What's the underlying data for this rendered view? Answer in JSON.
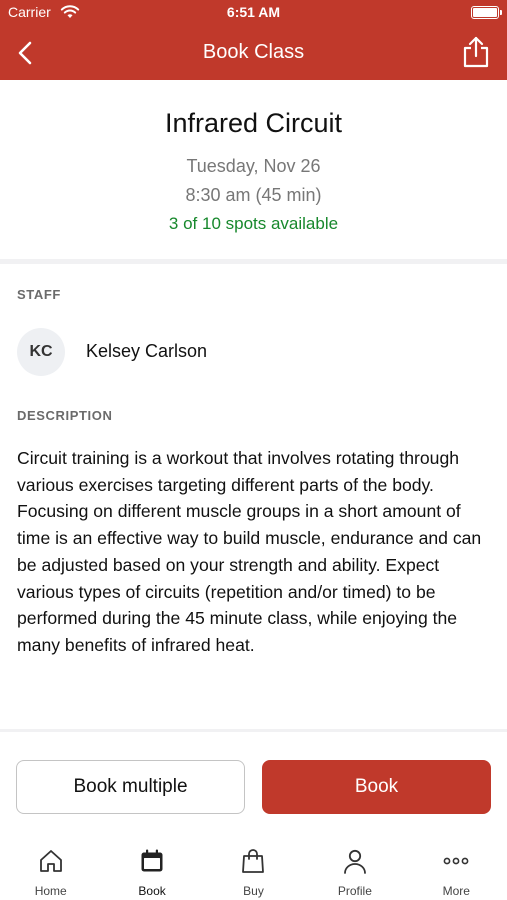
{
  "status_bar": {
    "carrier": "Carrier",
    "time": "6:51 AM"
  },
  "nav": {
    "title": "Book Class",
    "back_icon": "chevron-left-icon",
    "share_icon": "share-icon"
  },
  "class": {
    "name": "Infrared Circuit",
    "date": "Tuesday, Nov 26",
    "time": "8:30 am (45 min)",
    "spots": "3 of 10 spots available"
  },
  "staff": {
    "label": "STAFF",
    "initials": "KC",
    "name": "Kelsey Carlson"
  },
  "description": {
    "label": "DESCRIPTION",
    "text": "Circuit training is a workout that involves rotating through various exercises targeting different parts of the body. Focusing on different muscle groups in a short amount of time is an effective way to build muscle, endurance and can be adjusted based on your strength and ability. Expect various types of circuits (repetition and/or timed) to be performed during the 45 minute class, while enjoying the many benefits of infrared heat."
  },
  "actions": {
    "book_multiple": "Book multiple",
    "book": "Book"
  },
  "tabs": [
    {
      "label": "Home",
      "icon": "home-icon"
    },
    {
      "label": "Book",
      "icon": "calendar-icon",
      "active": true
    },
    {
      "label": "Buy",
      "icon": "shopping-bag-icon"
    },
    {
      "label": "Profile",
      "icon": "person-icon"
    },
    {
      "label": "More",
      "icon": "more-icon"
    }
  ],
  "colors": {
    "brand": "#c0392b",
    "available": "#17882c"
  }
}
